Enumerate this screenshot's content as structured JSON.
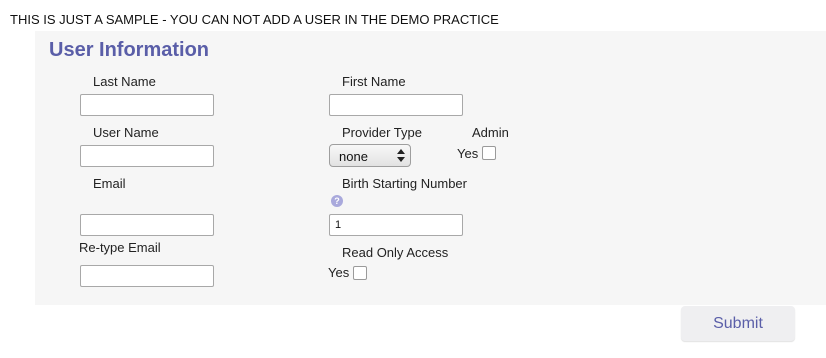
{
  "notice": "THIS IS JUST A SAMPLE - YOU CAN NOT ADD A USER IN THE DEMO PRACTICE",
  "form": {
    "title": "User Information",
    "last_name": {
      "label": "Last Name",
      "value": ""
    },
    "first_name": {
      "label": "First Name",
      "value": ""
    },
    "user_name": {
      "label": "User Name",
      "value": ""
    },
    "provider_type": {
      "label": "Provider Type",
      "value": "none"
    },
    "admin": {
      "label": "Admin",
      "yes_label": "Yes",
      "checked": false
    },
    "email": {
      "label": "Email",
      "value": ""
    },
    "birth_starting_number": {
      "label": "Birth Starting Number",
      "value": "1",
      "help_icon": "question-icon"
    },
    "retype_email": {
      "label": "Re-type Email",
      "value": ""
    },
    "read_only_access": {
      "label": "Read Only Access",
      "yes_label": "Yes",
      "checked": false
    },
    "submit_label": "Submit"
  },
  "colors": {
    "title": "#5a5ea8",
    "panel_bg": "#f6f6f6",
    "help_icon": "#a9a9dc"
  }
}
